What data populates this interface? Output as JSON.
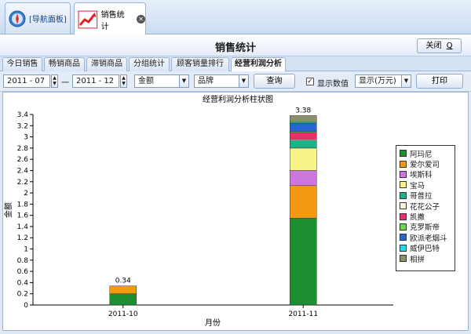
{
  "app_tabs": [
    {
      "label": "[导航面板]",
      "icon": "compass-icon"
    },
    {
      "label": "销售统计",
      "icon": "trend-chart-icon"
    }
  ],
  "page_title": "销售统计",
  "close_button": "关闭",
  "close_shortcut": "Q",
  "tabs": [
    "今日销售",
    "畅销商品",
    "滞销商品",
    "分组统计",
    "顾客销量排行",
    "经营利润分析"
  ],
  "active_tab": "经营利润分析",
  "toolbar": {
    "date_from": "2011 - 07",
    "date_sep": "一",
    "date_to": "2011 - 12",
    "metric": "金额",
    "group_by": "品牌",
    "query_label": "查询",
    "show_values_label": "显示数值",
    "show_values_checked": true,
    "unit": "显示(万元)",
    "print_label": "打印"
  },
  "colors": {
    "阿玛尼": "#1d8f33",
    "爱尔爱司": "#f39a12",
    "埃斯科": "#cc77dd",
    "宝马": "#f8f48a",
    "哥普拉": "#1fb08a",
    "花花公子": "#fdf5dc",
    "凯撒": "#e8306a",
    "克罗斯帝": "#6fd64d",
    "欧派老烟斗": "#2a63d6",
    "威伊巴特": "#28d7e8",
    "相拼": "#8c8f6a"
  },
  "chart_data": {
    "type": "bar",
    "stacked": true,
    "title": "经营利润分析柱状图",
    "xlabel": "月份",
    "ylabel": "金额",
    "categories": [
      "2011-10",
      "2011-11"
    ],
    "ylim": [
      0,
      3.4
    ],
    "yticks": [
      "0",
      "0.2",
      "0.4",
      "0.6",
      "0.8",
      "1",
      "1.2",
      "1.4",
      "1.6",
      "1.8",
      "2",
      "2.2",
      "2.4",
      "2.6",
      "2.8",
      "3",
      "3.2",
      "3.4"
    ],
    "totals": [
      "0.34",
      "3.38"
    ],
    "legend_position": "right",
    "series": [
      {
        "name": "阿玛尼",
        "values": [
          0.2,
          1.55
        ]
      },
      {
        "name": "爱尔爱司",
        "values": [
          0.14,
          0.58
        ]
      },
      {
        "name": "埃斯科",
        "values": [
          0,
          0.27
        ]
      },
      {
        "name": "宝马",
        "values": [
          0,
          0.4
        ]
      },
      {
        "name": "哥普拉",
        "values": [
          0,
          0.13
        ]
      },
      {
        "name": "花花公子",
        "values": [
          0,
          0.02
        ]
      },
      {
        "name": "凯撒",
        "values": [
          0,
          0.13
        ]
      },
      {
        "name": "克罗斯帝",
        "values": [
          0,
          0.02
        ]
      },
      {
        "name": "欧派老烟斗",
        "values": [
          0,
          0.14
        ]
      },
      {
        "name": "威伊巴特",
        "values": [
          0,
          0.02
        ]
      },
      {
        "name": "相拼",
        "values": [
          0,
          0.12
        ]
      }
    ]
  }
}
